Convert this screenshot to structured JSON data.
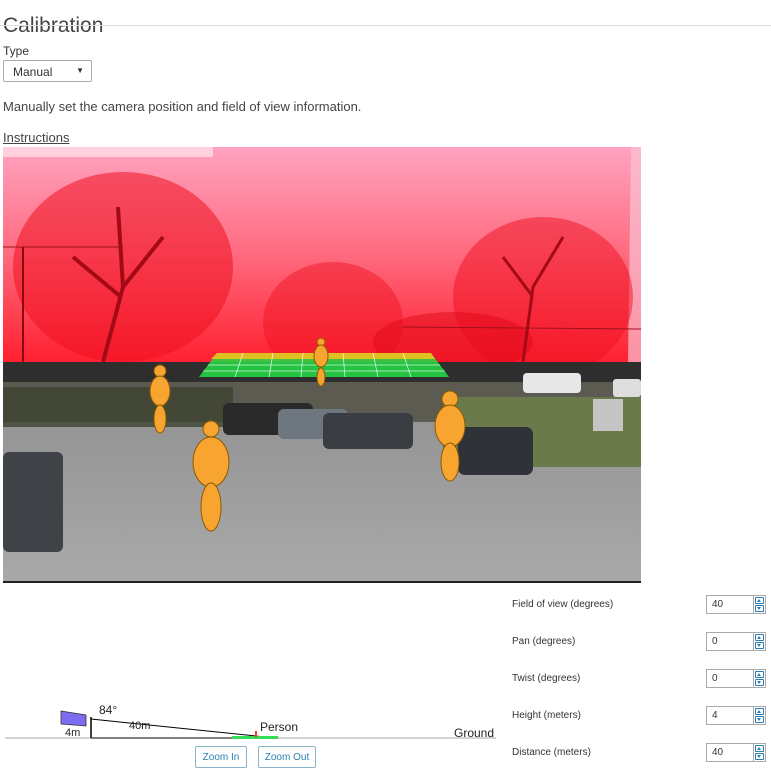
{
  "page": {
    "title": "Calibration"
  },
  "type_select": {
    "label": "Type",
    "value": "Manual"
  },
  "description": "Manually set the camera position and field of view information.",
  "instructions_link": "Instructions",
  "camera_view": {
    "overlay_color": "#ff1a3a",
    "grid_color": "#22dd44",
    "figure_color": "#f7a530"
  },
  "diagram": {
    "angle": "84°",
    "camera_height": "4m",
    "distance": "40m",
    "person": "Person",
    "ground": "Ground",
    "camera_color": "#7b6cf0"
  },
  "buttons": {
    "zoom_in": "Zoom In",
    "zoom_out": "Zoom Out"
  },
  "params": [
    {
      "label": "Field of view (degrees)",
      "value": "40"
    },
    {
      "label": "Pan (degrees)",
      "value": "0"
    },
    {
      "label": "Twist (degrees)",
      "value": "0"
    },
    {
      "label": "Height (meters)",
      "value": "4"
    },
    {
      "label": "Distance (meters)",
      "value": "40"
    }
  ]
}
